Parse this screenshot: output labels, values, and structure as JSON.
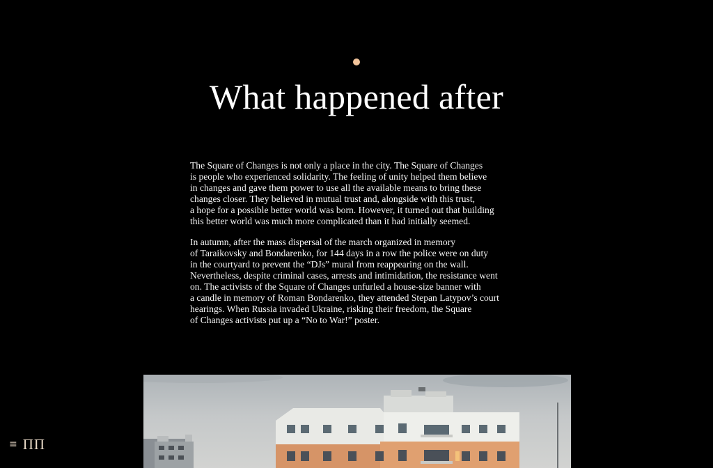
{
  "article": {
    "title": "What happened after",
    "paragraphs": [
      "The Square of Changes is not only a place in the city. The Square of Changes\nis people who experienced solidarity. The feeling of unity helped them believe\nin changes and gave them power to use all the available means to bring these\nchanges closer. They believed in mutual trust and, alongside with this trust,\na hope for a possible better world was born. However, it turned out that building\nthis better world was much more complicated than it had initially seemed.",
      "In autumn, after the mass dispersal of the march organized in memory\nof Taraikovsky and Bondarenko, for 144 days in a row the police were on duty\nin the courtyard to prevent the “DJs” mural from reappearing on the wall.\nNevertheless, despite criminal cases, arrests and intimidation, the resistance went\non. The activists of the Square of Changes unfurled a house-size banner with\na candle in memory of Roman Bondarenko, they attended Stepan Latypov’s court\nhearings. When Russia invaded Ukraine, risking their freedom, the Square\nof Changes activists put up a “No to War!” poster."
    ]
  },
  "nav": {
    "menu_icon": "≡",
    "logo": "ПП"
  },
  "colors": {
    "background": "#000000",
    "accent_dot": "#f2c49b",
    "menu_text": "#e8d9c6"
  },
  "icons": {
    "menu": "menu-icon",
    "logo": "logo-icon"
  }
}
